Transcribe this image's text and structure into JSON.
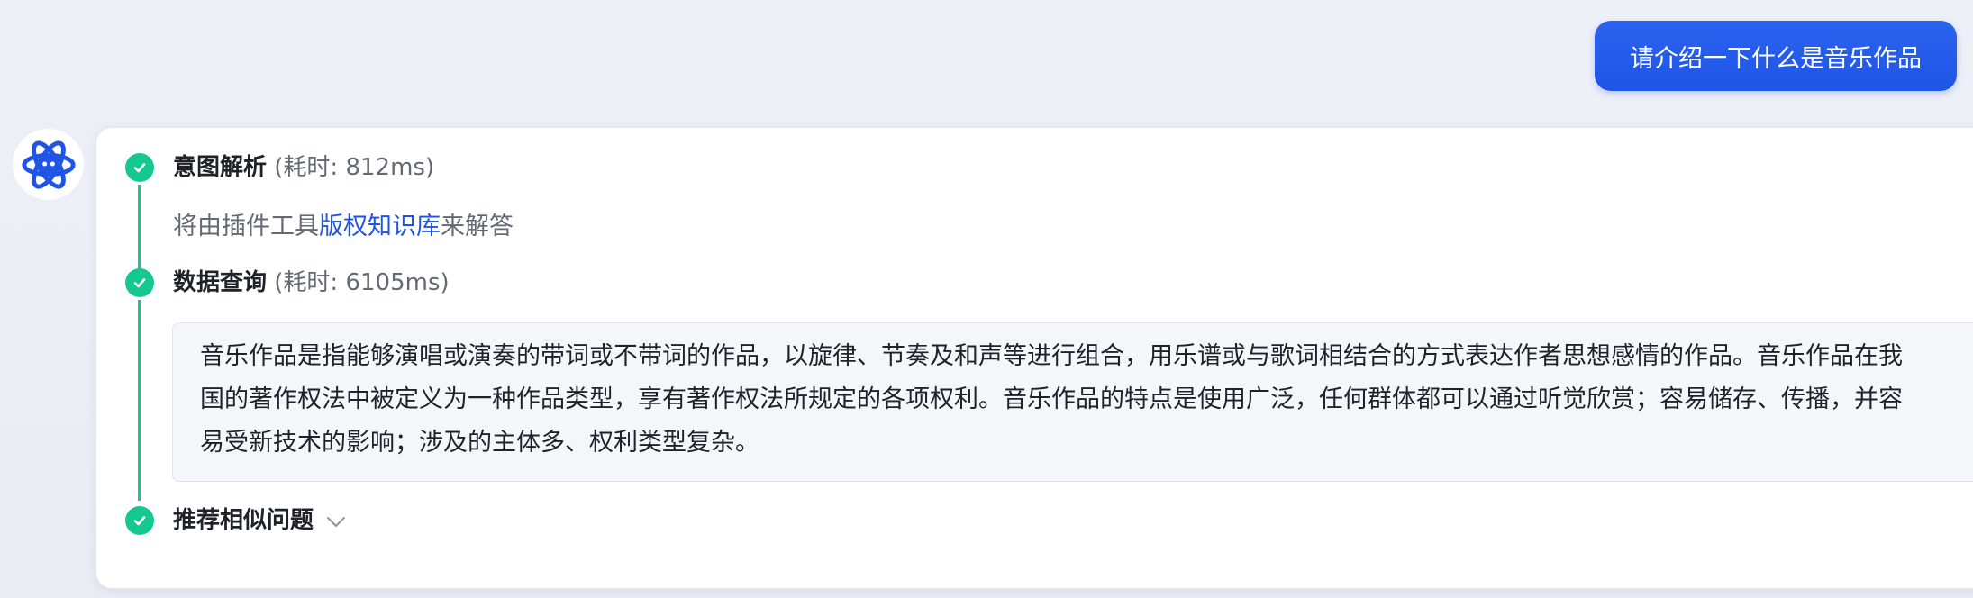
{
  "user_message": "请介绍一下什么是音乐作品",
  "avatar": {
    "icon": "atom-robot-icon",
    "color": "#1f55e6"
  },
  "steps": [
    {
      "title": "意图解析",
      "duration": "(耗时: 812ms)",
      "status": "done",
      "content": {
        "prefix": "将由插件工具",
        "tool": "版权知识库",
        "suffix": "来解答"
      }
    },
    {
      "title": "数据查询",
      "duration": "(耗时: 6105ms)",
      "status": "done",
      "content": {
        "lines": [
          "音乐作品是指能够演唱或演奏的带词或不带词的作品，以旋律、节奏及和声等进行组合，用乐谱或与歌词相结合的方式表达作者思想感情的作品。音乐作品在我",
          "国的著作权法中被定义为一种作品类型，享有著作权法所规定的各项权利。音乐作品的特点是使用广泛，任何群体都可以通过听觉欣赏；容易储存、传播，并容",
          "易受新技术的影响；涉及的主体多、权利类型复杂。"
        ]
      }
    },
    {
      "title": "推荐相似问题",
      "status": "done",
      "collapsed_icon": "chevron-down-icon"
    }
  ],
  "colors": {
    "accent": "#1f55e6",
    "success": "#13c98f",
    "muted_text": "#646a73"
  }
}
